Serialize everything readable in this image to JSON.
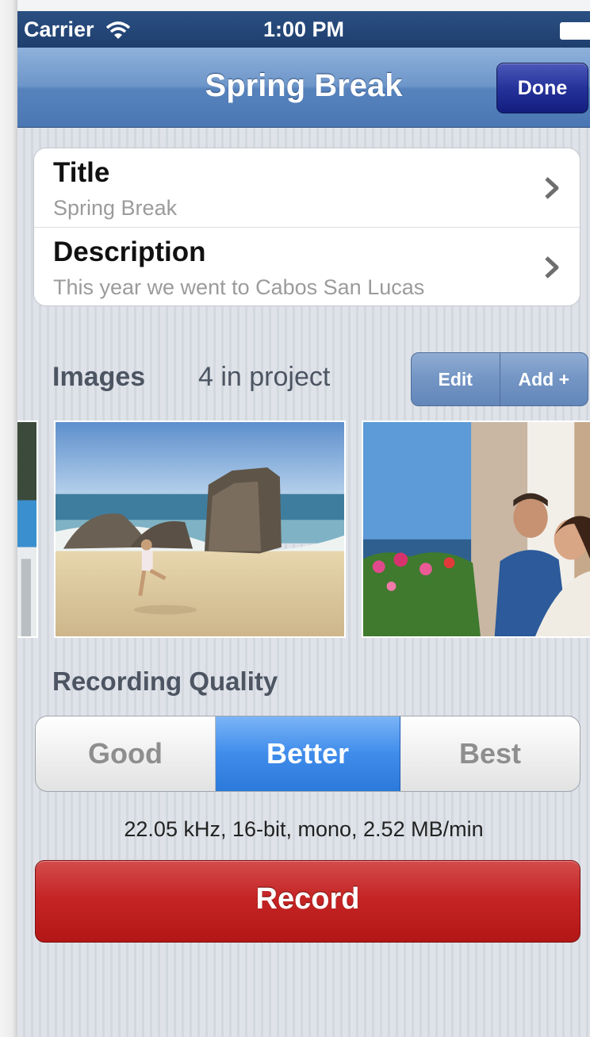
{
  "status_bar": {
    "carrier": "Carrier",
    "time": "1:00 PM",
    "wifi_icon": "wifi-icon",
    "battery_icon": "battery-icon"
  },
  "nav": {
    "title": "Spring Break",
    "done_label": "Done",
    "bar_color": "#5f8bc4",
    "done_color": "#1f2a8f"
  },
  "details": {
    "rows": [
      {
        "label": "Title",
        "value": "Spring Break"
      },
      {
        "label": "Description",
        "value": "This year we went to Cabos San Lucas"
      }
    ]
  },
  "images": {
    "label": "Images",
    "count_text": "4 in project",
    "edit_label": "Edit",
    "add_label": "Add +"
  },
  "recording": {
    "label": "Recording Quality",
    "options": [
      "Good",
      "Better",
      "Best"
    ],
    "selected": "Better",
    "spec_text": "22.05 kHz, 16-bit, mono, 2.52 MB/min",
    "record_label": "Record",
    "record_color": "#c52525",
    "selected_color": "#3f8ceb"
  }
}
